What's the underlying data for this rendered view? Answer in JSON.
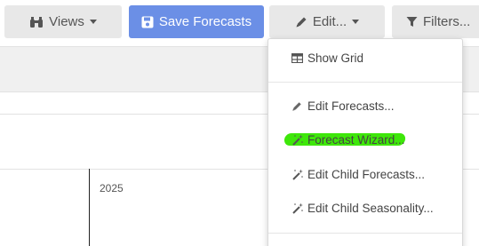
{
  "toolbar": {
    "views_label": "Views",
    "save_label": "Save Forecasts",
    "edit_label": "Edit...",
    "filters_label": "Filters..."
  },
  "timeline": {
    "year": "2025"
  },
  "edit_menu": {
    "items": [
      {
        "label": "Show Grid",
        "icon": "table-icon"
      },
      {
        "label": "Edit Forecasts...",
        "icon": "pencil-icon"
      },
      {
        "label": "Forecast Wizard...",
        "icon": "magic-wand-icon"
      },
      {
        "label": "Edit Child Forecasts...",
        "icon": "magic-wand-icon"
      },
      {
        "label": "Edit Child Seasonality...",
        "icon": "magic-wand-icon"
      }
    ]
  },
  "colors": {
    "primary": "#6b8fe6",
    "highlight": "#3ee70a"
  }
}
